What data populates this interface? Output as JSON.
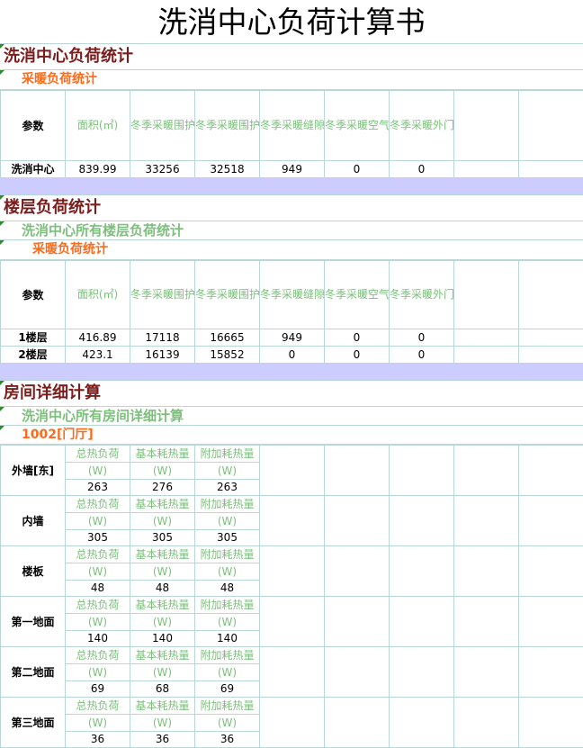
{
  "title": "洗消中心负荷计算书",
  "section1": {
    "title": "洗消中心负荷统计",
    "sub": "采暖负荷统计",
    "headers": [
      "参数",
      "面积(㎡)",
      "冬季采暖围护结构基本耗热量(W)",
      "冬季采暖围护结构附加耗热量(W)",
      "冬季采暖缝隙渗透耗热量(W)",
      "冬季采暖空气渗透耗热量(W)",
      "冬季采暖外门开启冲入冷风耗热量(W)"
    ],
    "rows": [
      [
        "洗消中心",
        "839.99",
        "33256",
        "32518",
        "949",
        "0",
        "0"
      ]
    ]
  },
  "section2": {
    "title": "楼层负荷统计",
    "sub": "洗消中心所有楼层负荷统计",
    "sub2": "采暖负荷统计",
    "headers": [
      "参数",
      "面积(㎡)",
      "冬季采暖围护结构基本耗热量(W)",
      "冬季采暖围护结构附加耗热量(W)",
      "冬季采暖缝隙渗透耗热量(W)",
      "冬季采暖空气渗透耗热量(W)",
      "冬季采暖外门开启冲入冷风耗热量(W)"
    ],
    "rows": [
      [
        "1楼层",
        "416.89",
        "17118",
        "16665",
        "949",
        "0",
        "0"
      ],
      [
        "2楼层",
        "423.1",
        "16139",
        "15852",
        "0",
        "0",
        "0"
      ]
    ]
  },
  "section3": {
    "title": "房间详细计算",
    "sub": "洗消中心所有房间详细计算",
    "room": "1002[门厅]",
    "col_heads": [
      "总热负荷",
      "基本耗热量",
      "附加耗热量"
    ],
    "unit": "(W)",
    "items": [
      {
        "name": "外墙[东]",
        "values": [
          "263",
          "276",
          "263"
        ]
      },
      {
        "name": "内墙",
        "values": [
          "305",
          "305",
          "305"
        ]
      },
      {
        "name": "楼板",
        "values": [
          "48",
          "48",
          "48"
        ]
      },
      {
        "name": "第一地面",
        "values": [
          "140",
          "140",
          "140"
        ]
      },
      {
        "name": "第二地面",
        "values": [
          "69",
          "68",
          "69"
        ]
      },
      {
        "name": "第三地面",
        "values": [
          "36",
          "36",
          "36"
        ]
      }
    ]
  }
}
